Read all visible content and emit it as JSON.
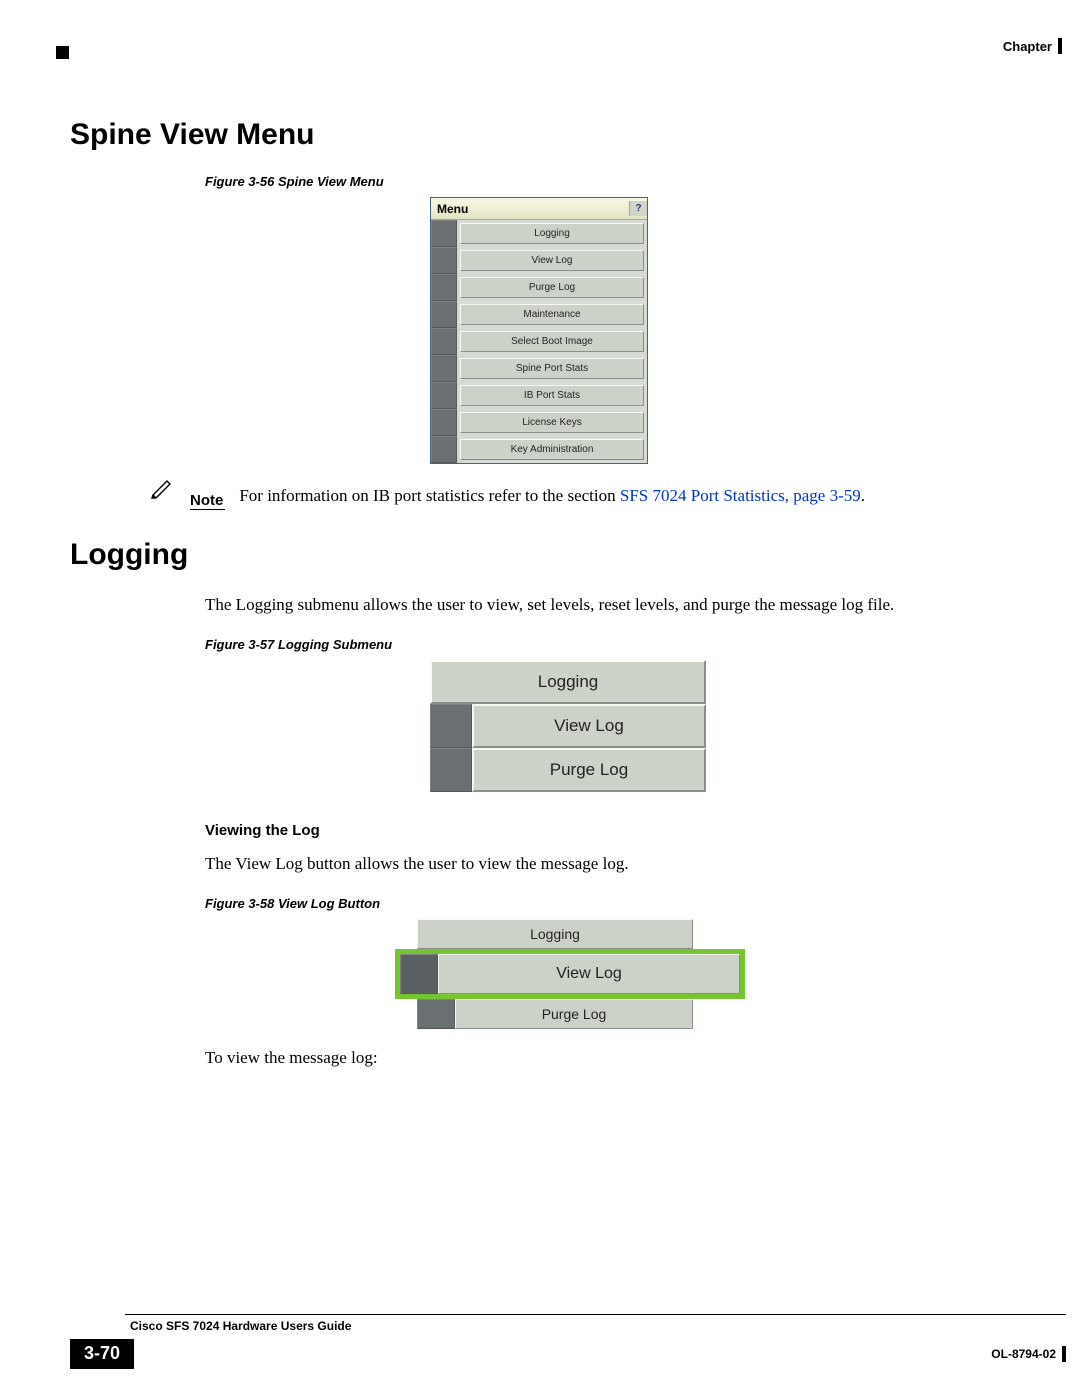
{
  "header": {
    "chapter_label": "Chapter"
  },
  "section1": {
    "title": "Spine View Menu",
    "figcaption": "Figure 3-56   Spine View Menu",
    "menu": {
      "title": "Menu",
      "items": [
        "Logging",
        "View Log",
        "Purge Log",
        "Maintenance",
        "Select Boot Image",
        "Spine Port Stats",
        "IB Port Stats",
        "License Keys",
        "Key Administration"
      ]
    }
  },
  "note": {
    "label": "Note",
    "text_prefix": "For information on IB port statistics refer to the section ",
    "link_text": "SFS 7024 Port Statistics, page 3-59",
    "suffix": "."
  },
  "section2": {
    "title": "Logging",
    "intro": "The Logging submenu allows the user to view, set levels, reset levels, and purge the message log file.",
    "figcaption": "Figure 3-57   Logging Submenu",
    "submenu": {
      "header": "Logging",
      "items": [
        "View Log",
        "Purge Log"
      ]
    },
    "sub": {
      "heading": "Viewing the Log",
      "text": "The View Log button allows the user to view the message log.",
      "figcaption": "Figure 3-58   View Log Button",
      "menu": {
        "header": "Logging",
        "highlighted": "View Log",
        "item2": "Purge Log"
      },
      "trail": "To view the message log:"
    }
  },
  "footer": {
    "guide": "Cisco SFS 7024 Hardware Users Guide",
    "page": "3-70",
    "docnum": "OL-8794-02"
  }
}
